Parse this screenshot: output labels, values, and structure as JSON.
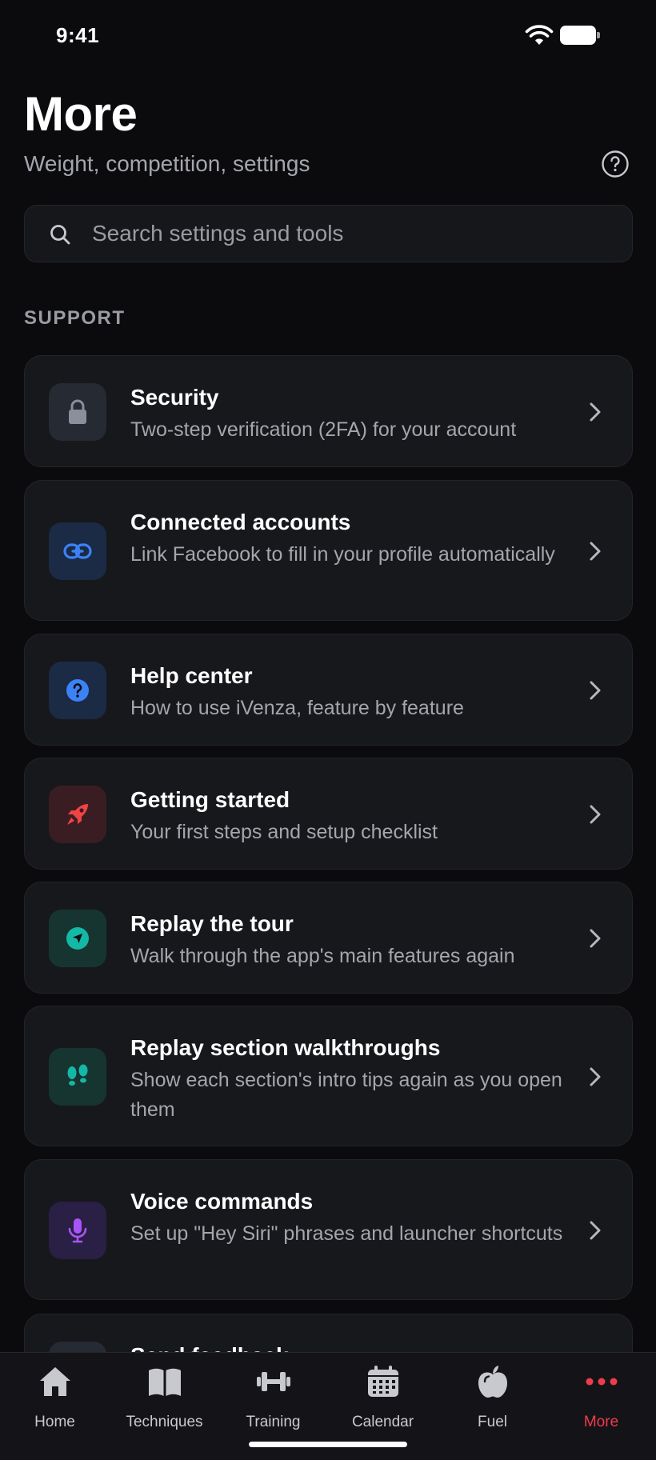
{
  "status_bar": {
    "time": "9:41"
  },
  "header": {
    "title": "More",
    "subtitle": "Weight, competition, settings"
  },
  "search": {
    "placeholder": "Search settings and tools"
  },
  "section": {
    "label": "SUPPORT"
  },
  "items": [
    {
      "title": "Security",
      "desc": "Two-step verification (2FA) for your account",
      "icon": "lock-icon",
      "color": "#8a8f9b"
    },
    {
      "title": "Connected accounts",
      "desc": "Link Facebook to fill in your profile automatically",
      "icon": "link-icon",
      "color": "#3b82f6"
    },
    {
      "title": "Help center",
      "desc": "How to use iVenza, feature by feature",
      "icon": "question-icon",
      "color": "#3b82f6"
    },
    {
      "title": "Getting started",
      "desc": "Your first steps and setup checklist",
      "icon": "rocket-icon",
      "color": "#ef4444"
    },
    {
      "title": "Replay the tour",
      "desc": "Walk through the app's main features again",
      "icon": "compass-icon",
      "color": "#14b8a6"
    },
    {
      "title": "Replay section walkthroughs",
      "desc": "Show each section's intro tips again as you open them",
      "icon": "footsteps-icon",
      "color": "#14b8a6"
    },
    {
      "title": "Voice commands",
      "desc": "Set up \"Hey Siri\" phrases and launcher shortcuts",
      "icon": "microphone-icon",
      "color": "#a855f7"
    },
    {
      "title": "Send feedback",
      "desc": "",
      "icon": "feedback-icon",
      "color": "#8a8f9b"
    }
  ],
  "tabs": [
    {
      "label": "Home",
      "icon": "home-icon",
      "active": false
    },
    {
      "label": "Techniques",
      "icon": "book-icon",
      "active": false
    },
    {
      "label": "Training",
      "icon": "dumbbell-icon",
      "active": false
    },
    {
      "label": "Calendar",
      "icon": "calendar-icon",
      "active": false
    },
    {
      "label": "Fuel",
      "icon": "apple-icon",
      "active": false
    },
    {
      "label": "More",
      "icon": "more-dots-icon",
      "active": true
    }
  ],
  "colors": {
    "accent": "#ef3b4b",
    "background": "#0b0b0e",
    "card": "#17181c"
  }
}
